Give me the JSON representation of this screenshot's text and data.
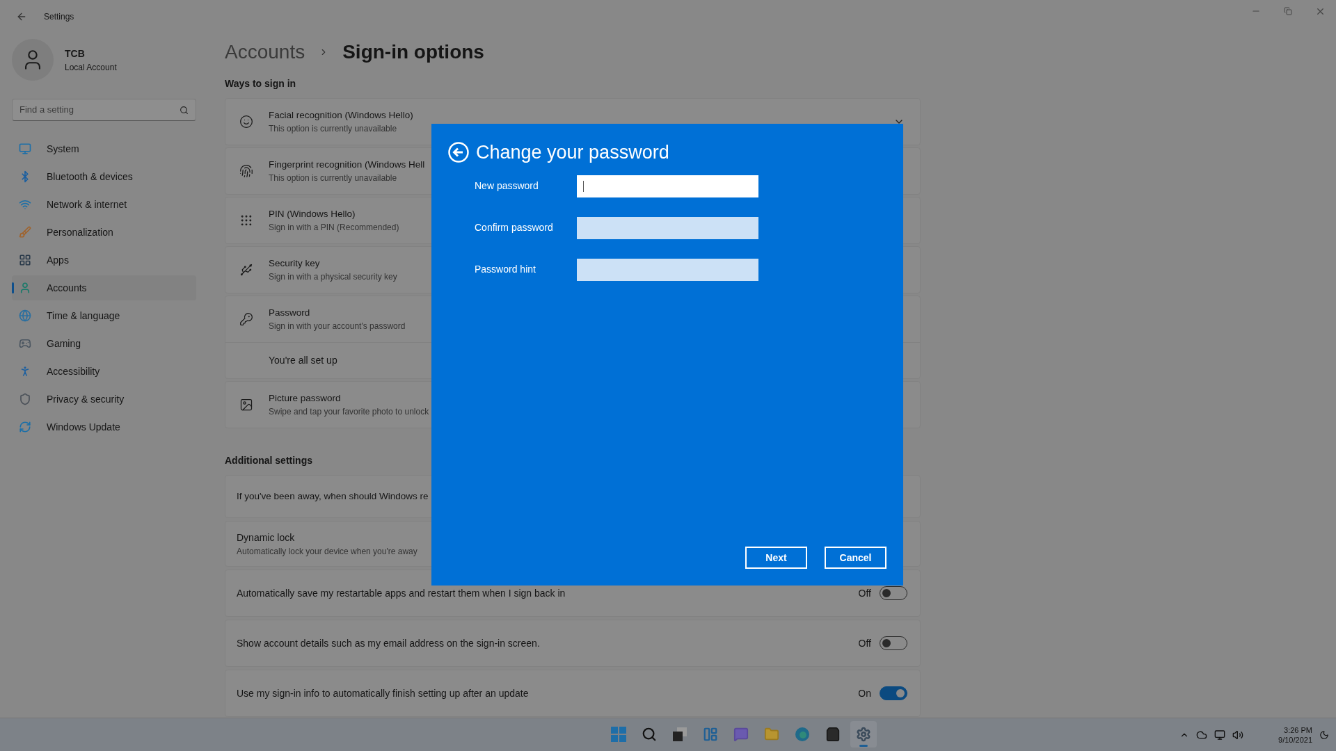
{
  "window": {
    "title": "Settings"
  },
  "user": {
    "name": "TCB",
    "type": "Local Account"
  },
  "search": {
    "placeholder": "Find a setting"
  },
  "sidebar": {
    "items": [
      {
        "kind": "system",
        "label": "System",
        "selected": false
      },
      {
        "kind": "bluetooth",
        "label": "Bluetooth & devices",
        "selected": false
      },
      {
        "kind": "network",
        "label": "Network & internet",
        "selected": false
      },
      {
        "kind": "personalization",
        "label": "Personalization",
        "selected": false
      },
      {
        "kind": "apps",
        "label": "Apps",
        "selected": false
      },
      {
        "kind": "accounts",
        "label": "Accounts",
        "selected": true
      },
      {
        "kind": "time",
        "label": "Time & language",
        "selected": false
      },
      {
        "kind": "gaming",
        "label": "Gaming",
        "selected": false
      },
      {
        "kind": "accessibility",
        "label": "Accessibility",
        "selected": false
      },
      {
        "kind": "privacy",
        "label": "Privacy & security",
        "selected": false
      },
      {
        "kind": "update",
        "label": "Windows Update",
        "selected": false
      }
    ]
  },
  "breadcrumb": [
    "Accounts",
    "Sign-in options"
  ],
  "ways_to_sign_in": {
    "heading": "Ways to sign in",
    "items": [
      {
        "kind": "face",
        "title": "Facial recognition (Windows Hello)",
        "subtitle": "This option is currently unavailable"
      },
      {
        "kind": "fingerprint",
        "title": "Fingerprint recognition (Windows Hell",
        "subtitle": "This option is currently unavailable"
      },
      {
        "kind": "pin",
        "title": "PIN (Windows Hello)",
        "subtitle": "Sign in with a PIN (Recommended)"
      },
      {
        "kind": "key",
        "title": "Security key",
        "subtitle": "Sign in with a physical security key"
      },
      {
        "kind": "password",
        "title": "Password",
        "subtitle": "Sign in with your account's password",
        "detail": "You're all set up"
      },
      {
        "kind": "picture",
        "title": "Picture password",
        "subtitle": "Swipe and tap your favorite photo to unlock"
      }
    ]
  },
  "additional_settings": {
    "heading": "Additional settings",
    "items": [
      {
        "kind": "plain",
        "label": "If you've been away, when should Windows re"
      },
      {
        "kind": "expander",
        "title": "Dynamic lock",
        "subtitle": "Automatically lock your device when you're away"
      },
      {
        "kind": "toggle",
        "label": "Automatically save my restartable apps and restart them when I sign back in",
        "state_label": "Off",
        "on": false
      },
      {
        "kind": "toggle",
        "label": "Show account details such as my email address on the sign-in screen.",
        "state_label": "Off",
        "on": false
      },
      {
        "kind": "toggle",
        "label": "Use my sign-in info to automatically finish setting up after an update",
        "state_label": "On",
        "on": true
      }
    ]
  },
  "dialog": {
    "title": "Change your password",
    "fields": [
      {
        "label": "New password",
        "focused": true
      },
      {
        "label": "Confirm password",
        "focused": false
      },
      {
        "label": "Password hint",
        "focused": false
      }
    ],
    "buttons": [
      "Next",
      "Cancel"
    ]
  },
  "taskbar": {
    "apps": [
      {
        "kind": "start",
        "selected": false
      },
      {
        "kind": "search",
        "selected": false
      },
      {
        "kind": "taskview",
        "selected": false
      },
      {
        "kind": "widgets",
        "selected": false
      },
      {
        "kind": "chat",
        "selected": false
      },
      {
        "kind": "explorer",
        "selected": false
      },
      {
        "kind": "edge",
        "selected": false
      },
      {
        "kind": "store",
        "selected": false
      },
      {
        "kind": "settings",
        "selected": true
      }
    ],
    "time": "3:26 PM",
    "date": "9/10/2021"
  }
}
